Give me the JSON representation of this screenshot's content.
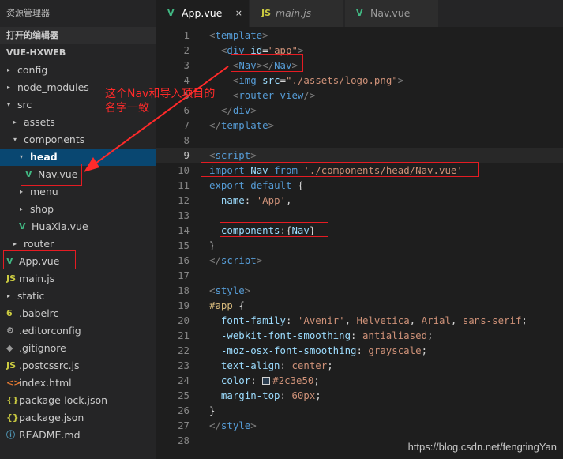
{
  "explorer": {
    "title": "资源管理器",
    "open_editors": "打开的编辑器",
    "project": "VUE-HXWEB",
    "items": [
      {
        "label": "config",
        "kind": "folder",
        "arrow": "▸"
      },
      {
        "label": "node_modules",
        "kind": "folder",
        "arrow": "▸"
      },
      {
        "label": "src",
        "kind": "folder",
        "arrow": "▾"
      },
      {
        "label": "assets",
        "kind": "folder",
        "arrow": "▸"
      },
      {
        "label": "components",
        "kind": "folder",
        "arrow": "▾"
      },
      {
        "label": "head",
        "kind": "folder",
        "arrow": "▾",
        "selected": true
      },
      {
        "label": "Nav.vue",
        "kind": "vue",
        "icon": "V"
      },
      {
        "label": "menu",
        "kind": "folder",
        "arrow": "▸"
      },
      {
        "label": "shop",
        "kind": "folder",
        "arrow": "▸"
      },
      {
        "label": "HuaXia.vue",
        "kind": "vue",
        "icon": "V"
      },
      {
        "label": "router",
        "kind": "folder",
        "arrow": "▸"
      },
      {
        "label": "App.vue",
        "kind": "vue",
        "icon": "V"
      },
      {
        "label": "main.js",
        "kind": "js",
        "icon": "JS"
      },
      {
        "label": "static",
        "kind": "folder",
        "arrow": "▸"
      },
      {
        "label": ".babelrc",
        "kind": "babel",
        "icon": "6"
      },
      {
        "label": ".editorconfig",
        "kind": "gear",
        "icon": "⚙"
      },
      {
        "label": ".gitignore",
        "kind": "git",
        "icon": "◆"
      },
      {
        "label": ".postcssrc.js",
        "kind": "js",
        "icon": "JS"
      },
      {
        "label": "index.html",
        "kind": "html",
        "icon": "<>"
      },
      {
        "label": "package-lock.json",
        "kind": "json",
        "icon": "{}"
      },
      {
        "label": "package.json",
        "kind": "json",
        "icon": "{}"
      },
      {
        "label": "README.md",
        "kind": "info",
        "icon": "ⓘ"
      }
    ]
  },
  "tabs": [
    {
      "label": "App.vue",
      "icon": "V",
      "active": true,
      "close": "×"
    },
    {
      "label": "main.js",
      "icon": "JS",
      "active": false
    },
    {
      "label": "Nav.vue",
      "icon": "V",
      "active": false
    }
  ],
  "code_lines": [
    {
      "n": "1",
      "html": "<span class='punc'>&lt;</span><span class='tag'>template</span><span class='punc'>&gt;</span>"
    },
    {
      "n": "2",
      "html": "  <span class='punc'>&lt;</span><span class='tag'>div</span> <span class='attr'>id</span><span class='txt'>=</span><span class='str'>\"app\"</span><span class='punc'>&gt;</span>"
    },
    {
      "n": "3",
      "html": "    <span class='punc'>&lt;</span><span class='tag'>Nav</span><span class='punc'>&gt;&lt;/</span><span class='tag'>Nav</span><span class='punc'>&gt;</span>"
    },
    {
      "n": "4",
      "html": "    <span class='punc'>&lt;</span><span class='tag'>img</span> <span class='attr'>src</span><span class='txt'>=</span><span class='str'>\"<span class='under'>./assets/logo.png</span>\"</span><span class='punc'>&gt;</span>"
    },
    {
      "n": "5",
      "html": "    <span class='punc'>&lt;</span><span class='tag'>router-view</span><span class='punc'>/&gt;</span>"
    },
    {
      "n": "6",
      "html": "  <span class='punc'>&lt;/</span><span class='tag'>div</span><span class='punc'>&gt;</span>"
    },
    {
      "n": "7",
      "html": "<span class='punc'>&lt;/</span><span class='tag'>template</span><span class='punc'>&gt;</span>"
    },
    {
      "n": "8",
      "html": ""
    },
    {
      "n": "9",
      "html": "<span class='punc'>&lt;</span><span class='tag'>script</span><span class='punc'>&gt;</span>",
      "current": true
    },
    {
      "n": "10",
      "html": "<span class='kw'>import</span> <span class='ident'>Nav</span> <span class='kw'>from</span> <span class='str'>'./components/head/Nav.vue'</span>"
    },
    {
      "n": "11",
      "html": "<span class='kw'>export</span> <span class='kw'>default</span> <span class='txt'>{</span>"
    },
    {
      "n": "12",
      "html": "  <span class='prop'>name</span><span class='txt'>: </span><span class='str'>'App'</span><span class='txt'>,</span>"
    },
    {
      "n": "13",
      "html": ""
    },
    {
      "n": "14",
      "html": "  <span class='prop'>components</span><span class='txt'>:{</span><span class='ident'>Nav</span><span class='txt'>}</span>"
    },
    {
      "n": "15",
      "html": "<span class='txt'>}</span>"
    },
    {
      "n": "16",
      "html": "<span class='punc'>&lt;/</span><span class='tag'>script</span><span class='punc'>&gt;</span>"
    },
    {
      "n": "17",
      "html": ""
    },
    {
      "n": "18",
      "html": "<span class='punc'>&lt;</span><span class='tag'>style</span><span class='punc'>&gt;</span>"
    },
    {
      "n": "19",
      "html": "<span class='sel'>#app</span> <span class='txt'>{</span>"
    },
    {
      "n": "20",
      "html": "  <span class='prop'>font-family</span><span class='txt'>: </span><span class='val'>'Avenir'</span><span class='txt'>, </span><span class='val'>Helvetica</span><span class='txt'>, </span><span class='val'>Arial</span><span class='txt'>, </span><span class='val'>sans-serif</span><span class='txt'>;</span>"
    },
    {
      "n": "21",
      "html": "  <span class='prop'>-webkit-font-smoothing</span><span class='txt'>: </span><span class='val'>antialiased</span><span class='txt'>;</span>"
    },
    {
      "n": "22",
      "html": "  <span class='prop'>-moz-osx-font-smoothing</span><span class='txt'>: </span><span class='val'>grayscale</span><span class='txt'>;</span>"
    },
    {
      "n": "23",
      "html": "  <span class='prop'>text-align</span><span class='txt'>: </span><span class='val'>center</span><span class='txt'>;</span>"
    },
    {
      "n": "24",
      "html": "  <span class='prop'>color</span><span class='txt'>: </span><span class='swatch'></span><span class='val'>#2c3e50</span><span class='txt'>;</span>"
    },
    {
      "n": "25",
      "html": "  <span class='prop'>margin-top</span><span class='txt'>: </span><span class='val'>60px</span><span class='txt'>;</span>"
    },
    {
      "n": "26",
      "html": "<span class='txt'>}</span>"
    },
    {
      "n": "27",
      "html": "<span class='punc'>&lt;/</span><span class='tag'>style</span><span class='punc'>&gt;</span>"
    },
    {
      "n": "28",
      "html": ""
    }
  ],
  "annotation": {
    "text": "这个Nav和导入项目的名字一致",
    "color": "#ff2a2a"
  },
  "watermark": "https://blog.csdn.net/fengtingYan",
  "colors": {
    "accent_red": "#e51c23",
    "selection": "#094771",
    "vue_green": "#41b883"
  }
}
